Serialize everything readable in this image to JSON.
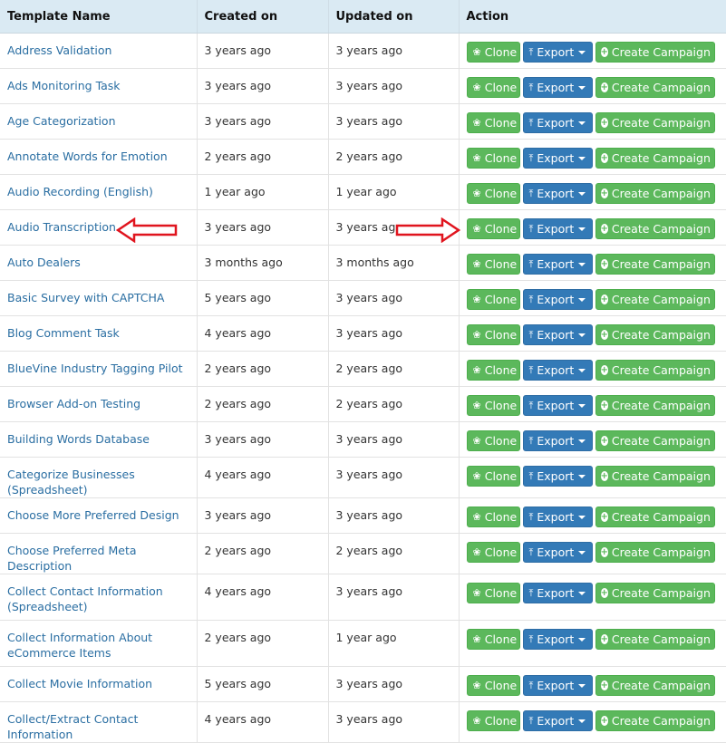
{
  "columns": [
    "Template Name",
    "Created on",
    "Updated on",
    "Action"
  ],
  "actions": {
    "clone": "Clone",
    "export": "Export",
    "create_campaign": "Create Campaign"
  },
  "rows": [
    {
      "name": "Address Validation",
      "created": "3 years ago",
      "updated": "3 years ago"
    },
    {
      "name": "Ads Monitoring Task",
      "created": "3 years ago",
      "updated": "3 years ago"
    },
    {
      "name": "Age Categorization",
      "created": "3 years ago",
      "updated": "3 years ago"
    },
    {
      "name": "Annotate Words for Emotion",
      "created": "2 years ago",
      "updated": "2 years ago"
    },
    {
      "name": "Audio Recording (English)",
      "created": "1 year ago",
      "updated": "1 year ago"
    },
    {
      "name": "Audio Transcription",
      "created": "3 years ago",
      "updated": "3 years ago"
    },
    {
      "name": "Auto Dealers",
      "created": "3 months ago",
      "updated": "3 months ago"
    },
    {
      "name": "Basic Survey with CAPTCHA",
      "created": "5 years ago",
      "updated": "3 years ago"
    },
    {
      "name": "Blog Comment Task",
      "created": "4 years ago",
      "updated": "3 years ago"
    },
    {
      "name": "BlueVine Industry Tagging Pilot",
      "created": "2 years ago",
      "updated": "2 years ago"
    },
    {
      "name": "Browser Add-on Testing",
      "created": "2 years ago",
      "updated": "2 years ago"
    },
    {
      "name": "Building Words Database",
      "created": "3 years ago",
      "updated": "3 years ago"
    },
    {
      "name": "Categorize Businesses (Spreadsheet)",
      "created": "4 years ago",
      "updated": "3 years ago"
    },
    {
      "name": "Choose More Preferred Design",
      "created": "3 years ago",
      "updated": "3 years ago"
    },
    {
      "name": "Choose Preferred Meta Description",
      "created": "2 years ago",
      "updated": "2 years ago"
    },
    {
      "name": "Collect Contact Information (Spreadsheet)",
      "created": "4 years ago",
      "updated": "3 years ago"
    },
    {
      "name": "Collect Information About eCommerce Items",
      "created": "2 years ago",
      "updated": "1 year ago"
    },
    {
      "name": "Collect Movie Information",
      "created": "5 years ago",
      "updated": "3 years ago"
    },
    {
      "name": "Collect/Extract Contact Information",
      "created": "4 years ago",
      "updated": "3 years ago"
    }
  ],
  "colors": {
    "header_bg": "#daeaf3",
    "link": "#2a6ea2",
    "success": "#5cb85c",
    "primary": "#337ab7",
    "annotation_arrow": "#e0141e"
  }
}
